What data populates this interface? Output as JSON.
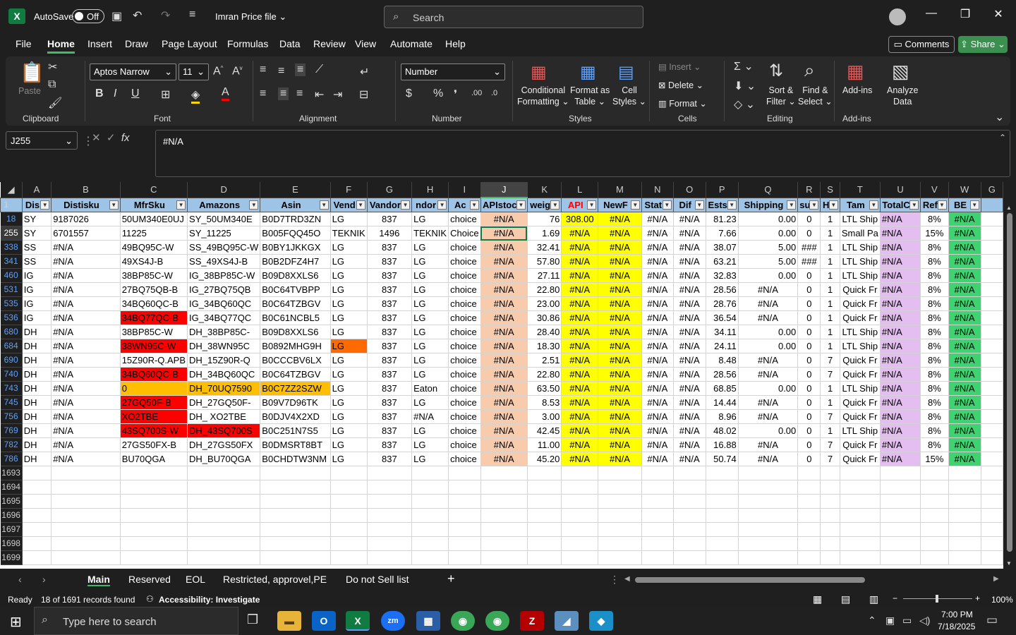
{
  "title": {
    "autosave": "AutoSave",
    "toggle": "Off",
    "file": "Imran Price file",
    "search": "Search"
  },
  "menu": [
    "File",
    "Home",
    "Insert",
    "Draw",
    "Page Layout",
    "Formulas",
    "Data",
    "Review",
    "View",
    "Automate",
    "Help"
  ],
  "actions": {
    "comments": "Comments",
    "share": "Share"
  },
  "ribbon": {
    "paste": "Paste",
    "font_name": "Aptos Narrow",
    "font_size": "11",
    "number_format": "Number",
    "conditional": "Conditional",
    "formatting": "Formatting",
    "format_as": "Format as",
    "table": "Table",
    "cell": "Cell",
    "styles": "Styles",
    "insert": "Insert",
    "delete": "Delete",
    "format": "Format",
    "sort": "Sort &",
    "filter": "Filter",
    "find": "Find &",
    "select": "Select",
    "addins": "Add-ins",
    "analyze": "Analyze",
    "data": "Data",
    "groups": [
      "Clipboard",
      "Font",
      "Alignment",
      "Number",
      "Styles",
      "Cells",
      "Editing",
      "Add-ins"
    ]
  },
  "formula": {
    "namebox": "J255",
    "content": "#N/A"
  },
  "columns": [
    "A",
    "B",
    "C",
    "D",
    "E",
    "F",
    "G",
    "H",
    "I",
    "J",
    "K",
    "L",
    "M",
    "N",
    "O",
    "P",
    "Q",
    "R",
    "S",
    "T",
    "U",
    "V",
    "W",
    "G"
  ],
  "header_row": {
    "num": "1",
    "cells": [
      "Dis",
      "Distisku",
      "MfrSku",
      "Amazons",
      "Asin",
      "Vend",
      "Vandor",
      "ndor",
      "Ac",
      "APIstoc",
      "weig",
      "API",
      "NewF",
      "Stat",
      "Dif",
      "Ests",
      "Shipping",
      "su",
      "H",
      "Tam",
      "TotalC",
      "Ref",
      "BE",
      ""
    ]
  },
  "rows": [
    {
      "n": "18",
      "c": [
        "SY",
        "9187026",
        "50UM340E0UJ",
        "SY_50UM340E",
        "B0D7TRD3ZN",
        "LG",
        "837",
        "LG",
        "choice",
        "#N/A",
        "76",
        "308.00",
        "#N/A",
        "#N/A",
        "#N/A",
        "81.23",
        "0.00",
        "0",
        "1",
        "LTL Ship",
        "#N/A",
        "8%",
        "#N/A",
        ""
      ]
    },
    {
      "n": "255",
      "c": [
        "SY",
        "6701557",
        "11225",
        "SY_11225",
        "B005FQQ45O",
        "TEKNIK",
        "1496",
        "TEKNIK",
        "Choice",
        "#N/A",
        "1.69",
        "#N/A",
        "#N/A",
        "#N/A",
        "#N/A",
        "7.66",
        "0.00",
        "0",
        "1",
        "Small Pa",
        "#N/A",
        "15%",
        "#N/A",
        ""
      ]
    },
    {
      "n": "338",
      "c": [
        "SS",
        "#N/A",
        "49BQ95C-W",
        "SS_49BQ95C-W",
        "B0BY1JKKGX",
        "LG",
        "837",
        "LG",
        "choice",
        "#N/A",
        "32.41",
        "#N/A",
        "#N/A",
        "#N/A",
        "#N/A",
        "38.07",
        "5.00",
        "###",
        "1",
        "LTL Ship",
        "#N/A",
        "8%",
        "#N/A",
        ""
      ]
    },
    {
      "n": "341",
      "c": [
        "SS",
        "#N/A",
        "49XS4J-B",
        "SS_49XS4J-B",
        "B0B2DFZ4H7",
        "LG",
        "837",
        "LG",
        "choice",
        "#N/A",
        "57.80",
        "#N/A",
        "#N/A",
        "#N/A",
        "#N/A",
        "63.21",
        "5.00",
        "###",
        "1",
        "LTL Ship",
        "#N/A",
        "8%",
        "#N/A",
        ""
      ]
    },
    {
      "n": "460",
      "c": [
        "IG",
        "#N/A",
        "38BP85C-W",
        "IG_38BP85C-W",
        "B09D8XXLS6",
        "LG",
        "837",
        "LG",
        "choice",
        "#N/A",
        "27.11",
        "#N/A",
        "#N/A",
        "#N/A",
        "#N/A",
        "32.83",
        "0.00",
        "0",
        "1",
        "LTL Ship",
        "#N/A",
        "8%",
        "#N/A",
        ""
      ]
    },
    {
      "n": "531",
      "c": [
        "IG",
        "#N/A",
        "27BQ75QB-B",
        "IG_27BQ75QB",
        "B0C64TVBPP",
        "LG",
        "837",
        "LG",
        "choice",
        "#N/A",
        "22.80",
        "#N/A",
        "#N/A",
        "#N/A",
        "#N/A",
        "28.56",
        "#N/A",
        "0",
        "1",
        "Quick Fr",
        "#N/A",
        "8%",
        "#N/A",
        ""
      ]
    },
    {
      "n": "535",
      "c": [
        "IG",
        "#N/A",
        "34BQ60QC-B",
        "IG_34BQ60QC",
        "B0C64TZBGV",
        "LG",
        "837",
        "LG",
        "choice",
        "#N/A",
        "23.00",
        "#N/A",
        "#N/A",
        "#N/A",
        "#N/A",
        "28.76",
        "#N/A",
        "0",
        "1",
        "Quick Fr",
        "#N/A",
        "8%",
        "#N/A",
        ""
      ]
    },
    {
      "n": "536",
      "c": [
        "IG",
        "#N/A",
        "34BQ77QC-B",
        "IG_34BQ77QC",
        "B0C61NCBL5",
        "LG",
        "837",
        "LG",
        "choice",
        "#N/A",
        "30.86",
        "#N/A",
        "#N/A",
        "#N/A",
        "#N/A",
        "36.54",
        "#N/A",
        "0",
        "1",
        "Quick Fr",
        "#N/A",
        "8%",
        "#N/A",
        ""
      ]
    },
    {
      "n": "680",
      "c": [
        "DH",
        "#N/A",
        "38BP85C-W",
        "DH_38BP85C-",
        "B09D8XXLS6",
        "LG",
        "837",
        "LG",
        "choice",
        "#N/A",
        "28.40",
        "#N/A",
        "#N/A",
        "#N/A",
        "#N/A",
        "34.11",
        "0.00",
        "0",
        "1",
        "LTL Ship",
        "#N/A",
        "8%",
        "#N/A",
        ""
      ]
    },
    {
      "n": "684",
      "c": [
        "DH",
        "#N/A",
        "38WN95C-W",
        "DH_38WN95C",
        "B0892MHG9H",
        "LG",
        "837",
        "LG",
        "choice",
        "#N/A",
        "18.30",
        "#N/A",
        "#N/A",
        "#N/A",
        "#N/A",
        "24.11",
        "0.00",
        "0",
        "1",
        "LTL Ship",
        "#N/A",
        "8%",
        "#N/A",
        ""
      ]
    },
    {
      "n": "690",
      "c": [
        "DH",
        "#N/A",
        "15Z90R-Q.APB",
        "DH_15Z90R-Q",
        "B0CCCBV6LX",
        "LG",
        "837",
        "LG",
        "choice",
        "#N/A",
        "2.51",
        "#N/A",
        "#N/A",
        "#N/A",
        "#N/A",
        "8.48",
        "#N/A",
        "0",
        "7",
        "Quick Fr",
        "#N/A",
        "8%",
        "#N/A",
        ""
      ]
    },
    {
      "n": "740",
      "c": [
        "DH",
        "#N/A",
        "34BQ60QC-B",
        "DH_34BQ60QC",
        "B0C64TZBGV",
        "LG",
        "837",
        "LG",
        "choice",
        "#N/A",
        "22.80",
        "#N/A",
        "#N/A",
        "#N/A",
        "#N/A",
        "28.56",
        "#N/A",
        "0",
        "7",
        "Quick Fr",
        "#N/A",
        "8%",
        "#N/A",
        ""
      ]
    },
    {
      "n": "743",
      "c": [
        "DH",
        "#N/A",
        "0",
        "DH_70UQ7590",
        "B0C7ZZ2SZW",
        "LG",
        "837",
        "Eaton",
        "choice",
        "#N/A",
        "63.50",
        "#N/A",
        "#N/A",
        "#N/A",
        "#N/A",
        "68.85",
        "0.00",
        "0",
        "1",
        "LTL Ship",
        "#N/A",
        "8%",
        "#N/A",
        ""
      ]
    },
    {
      "n": "745",
      "c": [
        "DH",
        "#N/A",
        "27GQ50F-B",
        "DH_27GQ50F-",
        "B09V7D96TK",
        "LG",
        "837",
        "LG",
        "choice",
        "#N/A",
        "8.53",
        "#N/A",
        "#N/A",
        "#N/A",
        "#N/A",
        "14.44",
        "#N/A",
        "0",
        "1",
        "Quick Fr",
        "#N/A",
        "8%",
        "#N/A",
        ""
      ]
    },
    {
      "n": "756",
      "c": [
        "DH",
        "#N/A",
        "XO2TBE",
        "DH_ XO2TBE",
        "B0DJV4X2XD",
        "LG",
        "837",
        "#N/A",
        "choice",
        "#N/A",
        "3.00",
        "#N/A",
        "#N/A",
        "#N/A",
        "#N/A",
        "8.96",
        "#N/A",
        "0",
        "7",
        "Quick Fr",
        "#N/A",
        "8%",
        "#N/A",
        ""
      ]
    },
    {
      "n": "769",
      "c": [
        "DH",
        "#N/A",
        "43SQ700S-W",
        "DH_43SQ700S",
        "B0C251N7S5",
        "LG",
        "837",
        "LG",
        "choice",
        "#N/A",
        "42.45",
        "#N/A",
        "#N/A",
        "#N/A",
        "#N/A",
        "48.02",
        "0.00",
        "0",
        "1",
        "LTL Ship",
        "#N/A",
        "8%",
        "#N/A",
        ""
      ]
    },
    {
      "n": "782",
      "c": [
        "DH",
        "#N/A",
        "27GS50FX-B",
        "DH_27GS50FX",
        "B0DMSRT8BT",
        "LG",
        "837",
        "LG",
        "choice",
        "#N/A",
        "11.00",
        "#N/A",
        "#N/A",
        "#N/A",
        "#N/A",
        "16.88",
        "#N/A",
        "0",
        "7",
        "Quick Fr",
        "#N/A",
        "8%",
        "#N/A",
        ""
      ]
    },
    {
      "n": "786",
      "c": [
        "DH",
        "#N/A",
        "BU70QGA",
        "DH_BU70QGA",
        "B0CHDTW3NM",
        "LG",
        "837",
        "LG",
        "choice",
        "#N/A",
        "45.20",
        "#N/A",
        "#N/A",
        "#N/A",
        "#N/A",
        "50.74",
        "#N/A",
        "0",
        "7",
        "Quick Fr",
        "#N/A",
        "15%",
        "#N/A",
        ""
      ]
    }
  ],
  "empty_rows": [
    "1693",
    "1694",
    "1695",
    "1696",
    "1697",
    "1698",
    "1699"
  ],
  "sheets": [
    "Main",
    "Reserved",
    "EOL",
    "Restricted, approvel,PE",
    "Do not Sell list"
  ],
  "status": {
    "ready": "Ready",
    "records": "18 of 1691 records found",
    "accessibility": "Accessibility: Investigate",
    "zoom": "100%"
  },
  "taskbar": {
    "search": "Type here to search",
    "time": "7:00 PM",
    "date": "7/18/2025"
  },
  "colors": {
    "accent": "#107c41",
    "header": "#9dc3e6",
    "red": "#ff0000",
    "yellow": "#ffff00",
    "salmon": "#f8cbad",
    "pink": "#e4bef0",
    "green": "#3ed270"
  }
}
